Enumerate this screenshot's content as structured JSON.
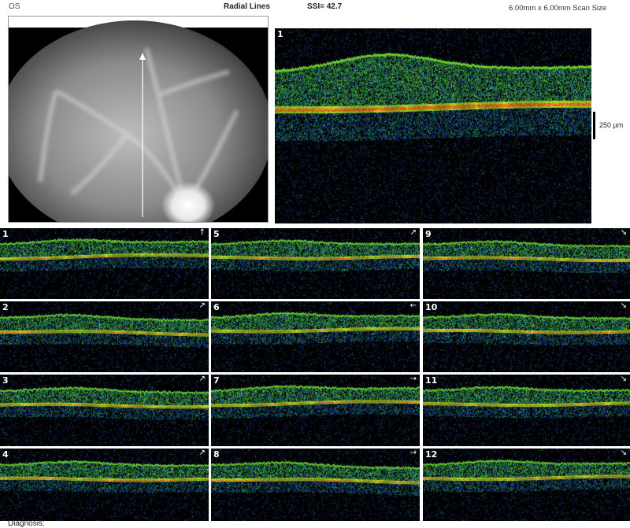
{
  "header": {
    "eye": "OS",
    "scan_type": "Radial Lines",
    "ssi": "SSI= 42.7",
    "scan_size": "6.00mm x 6.00mm Scan Size"
  },
  "main_scan": {
    "number": "1",
    "scale_bar_label": "250 µm"
  },
  "thumbnails": [
    {
      "number": "1",
      "direction_icon": "arrow-up-icon",
      "glyph": "↑"
    },
    {
      "number": "2",
      "direction_icon": "arrow-up-right-icon",
      "glyph": "↗"
    },
    {
      "number": "3",
      "direction_icon": "arrow-up-right-icon",
      "glyph": "↗"
    },
    {
      "number": "4",
      "direction_icon": "arrow-up-right-icon",
      "glyph": "↗"
    },
    {
      "number": "5",
      "direction_icon": "arrow-up-right-icon",
      "glyph": "↗"
    },
    {
      "number": "6",
      "direction_icon": "arrow-left-icon",
      "glyph": "←"
    },
    {
      "number": "7",
      "direction_icon": "arrow-right-icon",
      "glyph": "→"
    },
    {
      "number": "8",
      "direction_icon": "arrow-right-icon",
      "glyph": "→"
    },
    {
      "number": "9",
      "direction_icon": "arrow-down-right-icon",
      "glyph": "↘"
    },
    {
      "number": "10",
      "direction_icon": "arrow-down-right-icon",
      "glyph": "↘"
    },
    {
      "number": "11",
      "direction_icon": "arrow-down-right-icon",
      "glyph": "↘"
    },
    {
      "number": "12",
      "direction_icon": "arrow-down-right-icon",
      "glyph": "↘"
    }
  ],
  "footer": {
    "label": "Diagnosis:"
  },
  "colors": {
    "scan_background": "#000000",
    "rpe_band": "#e8a020",
    "retina_tissue": "#3cb83c",
    "noise": "#1a3a8a"
  }
}
